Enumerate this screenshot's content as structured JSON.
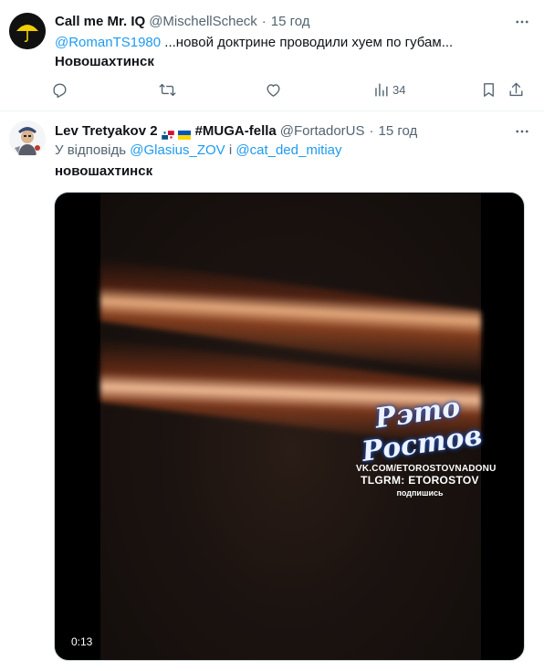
{
  "tweets": [
    {
      "name": "Call me Mr. IQ",
      "handle": "@MischellScheck",
      "separator": "·",
      "time": "15 год",
      "mention": "@RomanTS1980",
      "text": " ...новой доктрине проводили хуем по губам...",
      "location": "Новошахтинск",
      "views": "34"
    },
    {
      "name": "Lev Tretyakov 2",
      "name_suffix": "#MUGA-fella",
      "handle": "@FortadorUS",
      "separator": "·",
      "time": "15 год",
      "reply_prefix": "У відповідь",
      "reply_mention_1": "@Glasius_ZOV",
      "reply_conj": "і",
      "reply_mention_2": "@cat_ded_mitiay",
      "text": "новошахтинск",
      "video": {
        "duration": "0:13",
        "watermark_title": "Рэто Ростов",
        "watermark_url": "VK.COM/ETOROSTOVNADONU",
        "watermark_tg": "TLGRM: ETOROSTOV",
        "watermark_sub": "подпишись"
      }
    }
  ],
  "icons": [
    "more-icon",
    "reply-icon",
    "retweet-icon",
    "like-icon",
    "views-icon",
    "bookmark-icon",
    "share-icon"
  ],
  "colors": {
    "link": "#1d9bf0",
    "muted": "#536471",
    "text": "#0f1419"
  }
}
